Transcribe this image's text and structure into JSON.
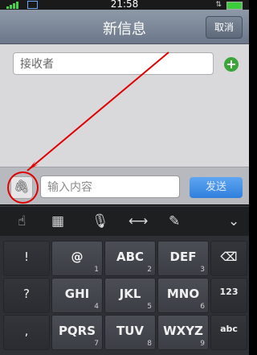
{
  "status": {
    "time": "21:58"
  },
  "navbar": {
    "title": "新信息",
    "cancel": "取消"
  },
  "recipient": {
    "placeholder": "接收者"
  },
  "composer": {
    "placeholder": "输入内容",
    "send": "发送"
  },
  "keyboard": {
    "punct": [
      "!",
      "?",
      ","
    ],
    "keys": [
      {
        "label": "@",
        "num": "1"
      },
      {
        "label": "ABC",
        "num": "2"
      },
      {
        "label": "DEF",
        "num": "3"
      },
      {
        "label": "GHI",
        "num": "4"
      },
      {
        "label": "JKL",
        "num": "5"
      },
      {
        "label": "MNO",
        "num": "6"
      },
      {
        "label": "PQRS",
        "num": "7"
      },
      {
        "label": "TUV",
        "num": "8"
      },
      {
        "label": "WXYZ",
        "num": "9"
      }
    ],
    "right_123": "123",
    "right_abc": "abc",
    "backspace": "⌫"
  }
}
